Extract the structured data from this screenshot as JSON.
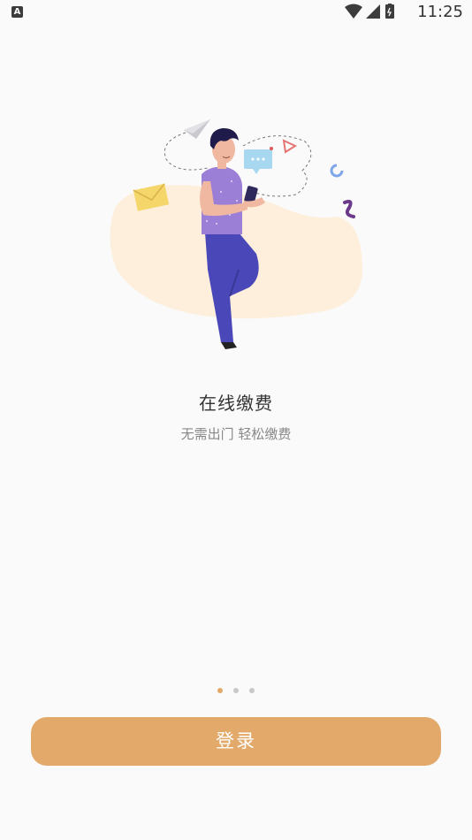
{
  "status_bar": {
    "left_icon_letter": "A",
    "time": "11:25",
    "icons": [
      "wifi-icon",
      "cell-signal-icon",
      "battery-icon"
    ]
  },
  "onboarding": {
    "title": "在线缴费",
    "subtitle": "无需出门 轻松缴费",
    "page_indicator": {
      "count": 3,
      "active_index": 0
    },
    "illustration": "man-with-phone-illustration"
  },
  "actions": {
    "login_label": "登录"
  },
  "colors": {
    "accent": "#e2a96b",
    "background": "#fafafa",
    "title": "#333333",
    "subtitle": "#888888"
  }
}
